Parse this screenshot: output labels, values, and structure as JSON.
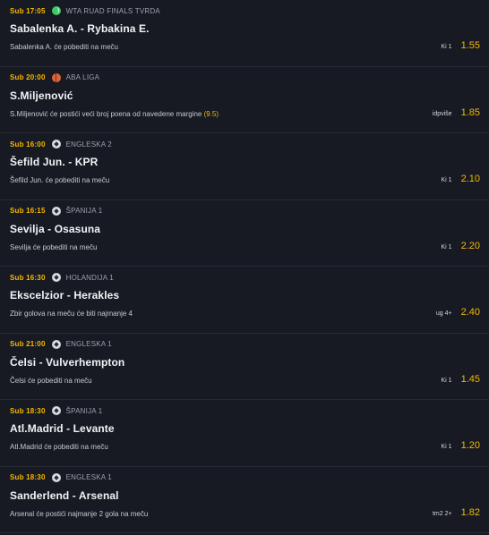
{
  "bets": [
    {
      "time": "Sub 17:05",
      "sport": "tennis",
      "league": "WTA RUAD FINALS TVRDA",
      "match": "Sabalenka A. - Rybakina E.",
      "desc": "Sabalenka A. će pobediti na meču",
      "desc_highlight": "",
      "tip": "Ki 1",
      "odd": "1.55"
    },
    {
      "time": "Sub 20:00",
      "sport": "basketball",
      "league": "ABA LIGA",
      "match": "S.Miljenović",
      "desc": "S.Miljenović će postići veći broj poena od navedene margine",
      "desc_highlight": "(9.5)",
      "tip": "idpviše",
      "odd": "1.85"
    },
    {
      "time": "Sub 16:00",
      "sport": "football",
      "league": "ENGLESKA 2",
      "match": "Šefild Jun. - KPR",
      "desc": "Šefild Jun. će pobediti na meču",
      "desc_highlight": "",
      "tip": "Ki 1",
      "odd": "2.10"
    },
    {
      "time": "Sub 16:15",
      "sport": "football",
      "league": "ŠPANIJA 1",
      "match": "Sevilja - Osasuna",
      "desc": "Sevilja će pobediti na meču",
      "desc_highlight": "",
      "tip": "Ki 1",
      "odd": "2.20"
    },
    {
      "time": "Sub 16:30",
      "sport": "football",
      "league": "HOLANDIJA 1",
      "match": "Ekscelzior - Herakles",
      "desc": "Zbir golova na meču će biti najmanje 4",
      "desc_highlight": "",
      "tip": "ug 4+",
      "odd": "2.40"
    },
    {
      "time": "Sub 21:00",
      "sport": "football",
      "league": "ENGLESKA 1",
      "match": "Čelsi - Vulverhempton",
      "desc": "Čelsi će pobediti na meču",
      "desc_highlight": "",
      "tip": "Ki 1",
      "odd": "1.45"
    },
    {
      "time": "Sub 18:30",
      "sport": "football",
      "league": "ŠPANIJA 1",
      "match": "Atl.Madrid - Levante",
      "desc": "Atl.Madrid će pobediti na meču",
      "desc_highlight": "",
      "tip": "Ki 1",
      "odd": "1.20"
    },
    {
      "time": "Sub 18:30",
      "sport": "football",
      "league": "ENGLESKA 1",
      "match": "Sanderlend - Arsenal",
      "desc": "Arsenal će postići najmanje 2 gola na meču",
      "desc_highlight": "",
      "tip": "tm2 2+",
      "odd": "1.82"
    }
  ]
}
